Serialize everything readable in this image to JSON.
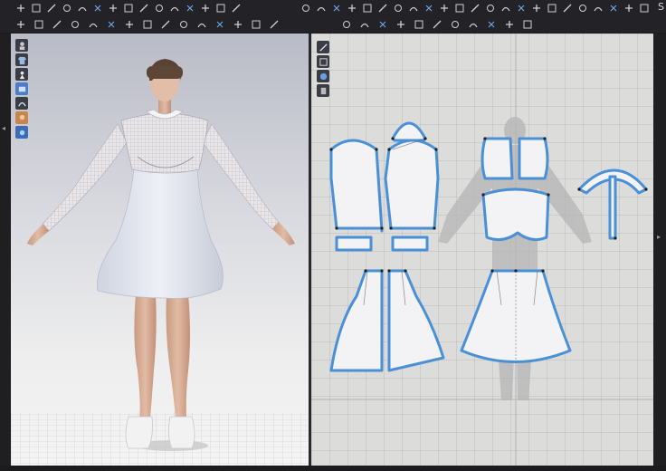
{
  "window": {
    "right_edge_label": "S"
  },
  "colors": {
    "pattern_outline": "#4a90d6",
    "pattern_fill": "#f3f3f5",
    "workspace_bg": "#dcdcda",
    "viewport_top": "#b9bbc6",
    "toolbar_bg": "#232327"
  },
  "toolbar_icons_row1": [
    "move-icon",
    "transform-pattern-icon",
    "edit-pattern-icon",
    "edit-curvature-icon",
    "add-point-icon",
    "rectangle-icon",
    "internal-shape-icon",
    "segment-sewing-icon",
    "free-sewing-icon",
    "fold-icon",
    "pin-icon",
    "avatar-icon",
    "arrangement-icon",
    "tack-icon",
    "trim-icon",
    "zoom-icon",
    "edit-pattern-icon-2",
    "transform-icon-2",
    "polygon-icon",
    "rectangle-icon-2",
    "circle-icon",
    "curve-point-icon",
    "internal-polygon-icon",
    "internal-rect-icon",
    "internal-circle-icon",
    "dart-icon",
    "trace-icon",
    "notch-icon",
    "seam-allowance-icon",
    "segment-sewing-icon-2",
    "free-sewing-icon-2",
    "check-sewing-icon",
    "puckering-icon",
    "pin-icon-2",
    "zipper-icon",
    "piping-icon",
    "elastic-icon",
    "grading-icon"
  ],
  "toolbar_icons_row2": [
    "select-mesh-icon",
    "brush-icon",
    "steam-icon",
    "tuck-icon",
    "smooth-icon",
    "measure-icon",
    "fold-arrange-icon",
    "texture-icon",
    "graphic-icon",
    "button-icon",
    "buttonhole-icon",
    "topstitch-icon",
    "select-fabric-icon",
    "edit-texture-icon",
    "sew-line-icon",
    "unfold-icon",
    "symmetry-icon",
    "baseline-icon",
    "offset-icon",
    "mirror-icon",
    "slash-icon",
    "spread-icon",
    "lengthen-icon",
    "smoothen-icon",
    "topstitch-icon-2",
    "line-tool-icon"
  ],
  "viewport3d_tools": [
    "display-avatar-icon",
    "display-garment-icon",
    "display-pattern-icon",
    "fabric-render-icon",
    "texture-mode-icon",
    "skin-icon",
    "light-icon"
  ],
  "viewport2d_tools": [
    "pattern-display-icon",
    "show-grid-icon",
    "fabric-color-icon",
    "thickness-icon"
  ]
}
